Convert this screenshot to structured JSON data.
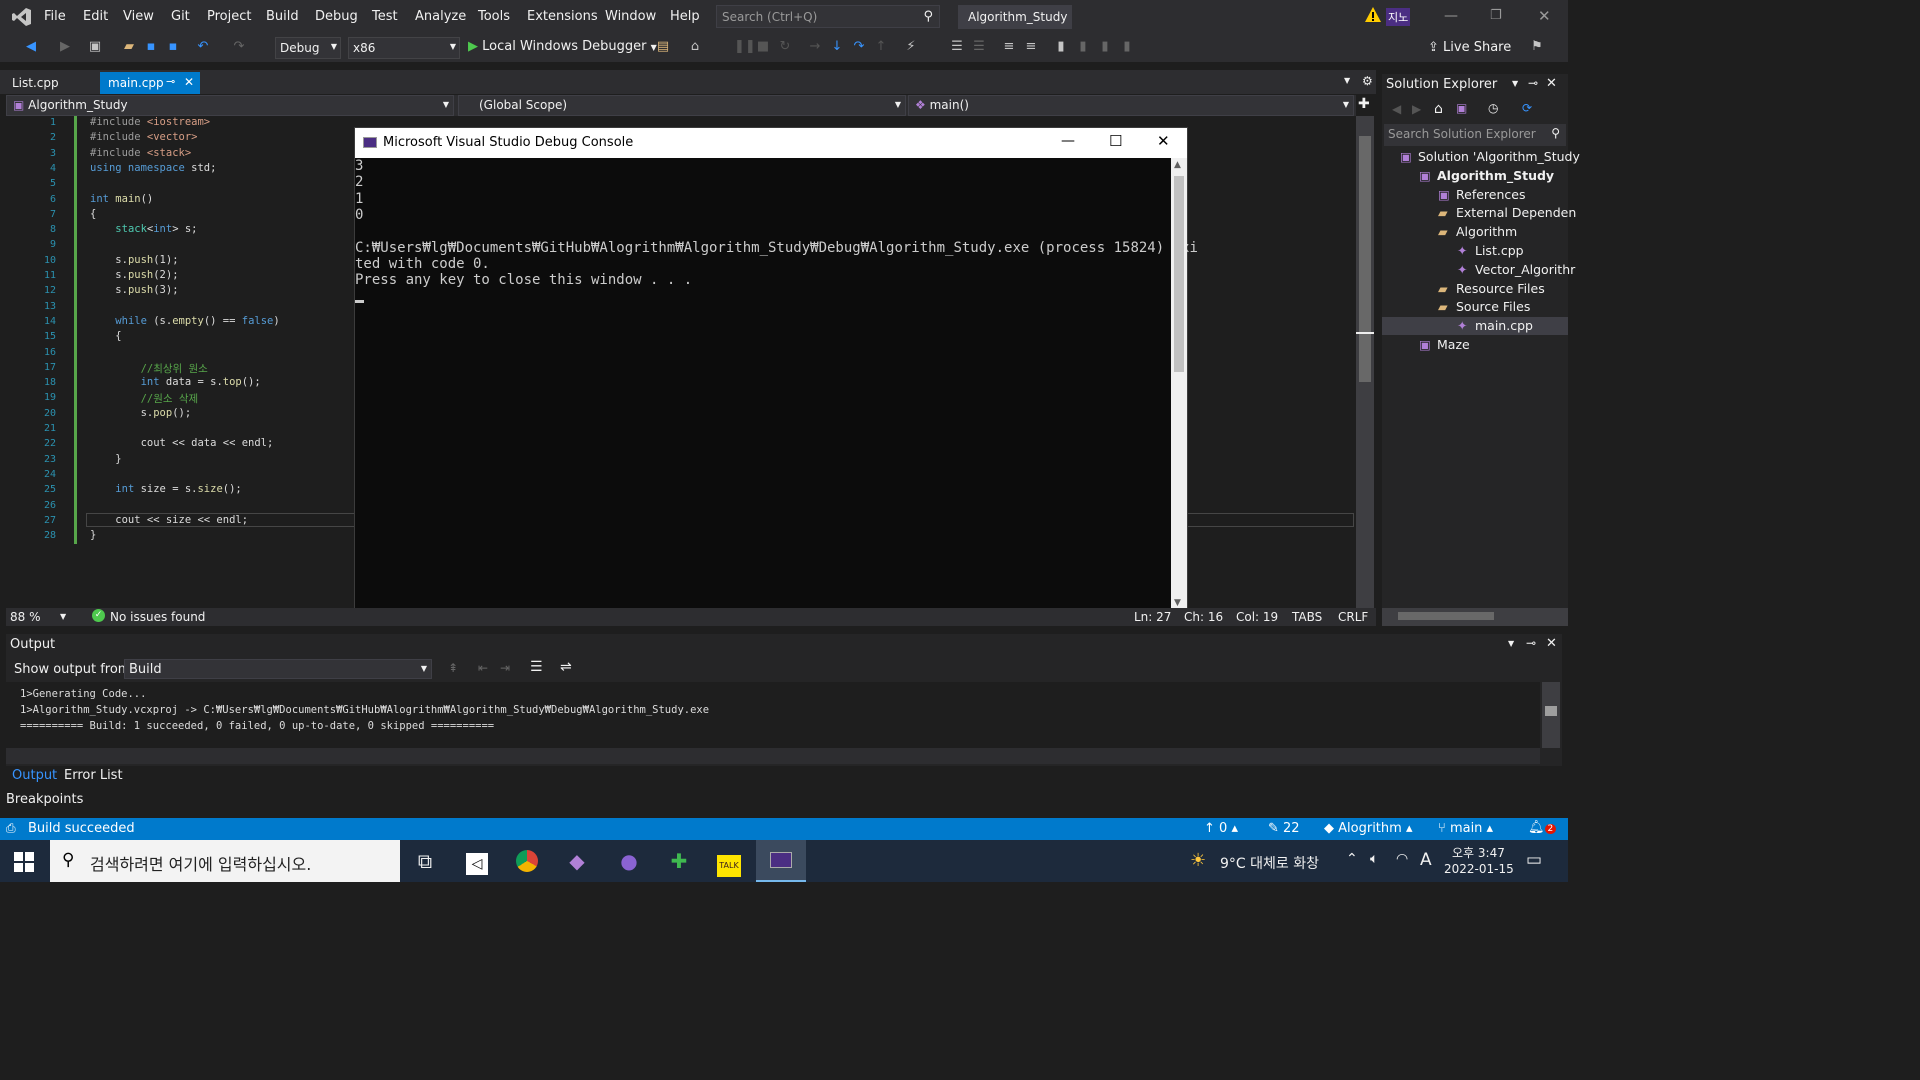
{
  "app": {
    "title": "Algorithm_Study"
  },
  "menu": [
    "File",
    "Edit",
    "View",
    "Git",
    "Project",
    "Build",
    "Debug",
    "Test",
    "Analyze",
    "Tools",
    "Extensions",
    "Window",
    "Help"
  ],
  "search": {
    "placeholder": "Search (Ctrl+Q)"
  },
  "user": {
    "initials": "지노"
  },
  "toolbar": {
    "config": "Debug",
    "platform": "x86",
    "debugger": "Local Windows Debugger",
    "live_share": "Live Share"
  },
  "tabs": [
    {
      "label": "List.cpp"
    },
    {
      "label": "main.cpp"
    }
  ],
  "nav": {
    "project": "Algorithm_Study",
    "scope": "(Global Scope)",
    "member": "main()"
  },
  "code_lines": [
    {
      "n": "1",
      "html": "<span class=\"mac\">#include</span> <span class=\"str\">&lt;iostream&gt;</span>"
    },
    {
      "n": "2",
      "html": "<span class=\"mac\">#include</span> <span class=\"str\">&lt;vector&gt;</span>"
    },
    {
      "n": "3",
      "html": "<span class=\"mac\">#include</span> <span class=\"str\">&lt;stack&gt;</span>"
    },
    {
      "n": "4",
      "html": "<span class=\"kw\">using namespace</span> std;"
    },
    {
      "n": "5",
      "html": ""
    },
    {
      "n": "6",
      "html": "<span class=\"kw\">int</span> <span class=\"fn\">main</span>()"
    },
    {
      "n": "7",
      "html": "{"
    },
    {
      "n": "8",
      "html": "    <span class=\"ty\">stack</span>&lt;<span class=\"kw\">int</span>&gt; s;"
    },
    {
      "n": "9",
      "html": ""
    },
    {
      "n": "10",
      "html": "    s.<span class=\"fn\">push</span>(1);"
    },
    {
      "n": "11",
      "html": "    s.<span class=\"fn\">push</span>(2);"
    },
    {
      "n": "12",
      "html": "    s.<span class=\"fn\">push</span>(3);"
    },
    {
      "n": "13",
      "html": ""
    },
    {
      "n": "14",
      "html": "    <span class=\"kw\">while</span> (s.<span class=\"fn\">empty</span>() == <span class=\"kw\">false</span>)"
    },
    {
      "n": "15",
      "html": "    {"
    },
    {
      "n": "16",
      "html": ""
    },
    {
      "n": "17",
      "html": "        <span class=\"cm\">//최상위 원소</span>"
    },
    {
      "n": "18",
      "html": "        <span class=\"kw\">int</span> data = s.<span class=\"fn\">top</span>();"
    },
    {
      "n": "19",
      "html": "        <span class=\"cm\">//원소 삭제</span>"
    },
    {
      "n": "20",
      "html": "        s.<span class=\"fn\">pop</span>();"
    },
    {
      "n": "21",
      "html": ""
    },
    {
      "n": "22",
      "html": "        cout &lt;&lt; data &lt;&lt; endl;"
    },
    {
      "n": "23",
      "html": "    }"
    },
    {
      "n": "24",
      "html": ""
    },
    {
      "n": "25",
      "html": "    <span class=\"kw\">int</span> size = s.<span class=\"fn\">size</span>();"
    },
    {
      "n": "26",
      "html": ""
    },
    {
      "n": "27",
      "html": "    cout &lt;&lt; size &lt;&lt; endl;"
    },
    {
      "n": "28",
      "html": "}"
    }
  ],
  "console": {
    "title": "Microsoft Visual Studio Debug Console",
    "lines": [
      "3",
      "2",
      "1",
      "0",
      "",
      "C:₩Users₩lg₩Documents₩GitHub₩Alogrithm₩Algorithm_Study₩Debug₩Algorithm_Study.exe (process 15824) exi",
      "ted with code 0.",
      "Press any key to close this window . . ."
    ]
  },
  "editor_status": {
    "zoom": "88 %",
    "issues": "No issues found",
    "ln": "Ln: 27",
    "ch": "Ch: 16",
    "col": "Col: 19",
    "tabs": "TABS",
    "crlf": "CRLF"
  },
  "solution_explorer": {
    "title": "Solution Explorer",
    "search_placeholder": "Search Solution Explorer",
    "items": [
      {
        "label": "Solution 'Algorithm_Study",
        "indent": 0,
        "icon": "solution-icon"
      },
      {
        "label": "Algorithm_Study",
        "indent": 1,
        "icon": "project-icon",
        "bold": true
      },
      {
        "label": "References",
        "indent": 2,
        "icon": "references-icon"
      },
      {
        "label": "External Dependen",
        "indent": 2,
        "icon": "folder-icon"
      },
      {
        "label": "Algorithm",
        "indent": 2,
        "icon": "folder-icon"
      },
      {
        "label": "List.cpp",
        "indent": 3,
        "icon": "cpp-file-icon"
      },
      {
        "label": "Vector_Algorithr",
        "indent": 3,
        "icon": "cpp-file-icon"
      },
      {
        "label": "Resource Files",
        "indent": 2,
        "icon": "folder-icon"
      },
      {
        "label": "Source Files",
        "indent": 2,
        "icon": "folder-icon"
      },
      {
        "label": "main.cpp",
        "indent": 3,
        "icon": "cpp-file-icon",
        "selected": true
      },
      {
        "label": "Maze",
        "indent": 1,
        "icon": "project-icon"
      }
    ]
  },
  "output": {
    "title": "Output",
    "show_from_label": "Show output from:",
    "source": "Build",
    "lines": [
      "1>Generating Code...",
      "1>Algorithm_Study.vcxproj -> C:₩Users₩lg₩Documents₩GitHub₩Alogrithm₩Algorithm_Study₩Debug₩Algorithm_Study.exe",
      "========== Build: 1 succeeded, 0 failed, 0 up-to-date, 0 skipped =========="
    ],
    "tabs": [
      "Output",
      "Error List"
    ],
    "breakpoints": "Breakpoints"
  },
  "statusbar": {
    "text": "Build succeeded",
    "up": "0",
    "edits": "22",
    "repo": "Alogrithm",
    "branch": "main",
    "notif": "2"
  },
  "taskbar": {
    "search_placeholder": "검색하려면 여기에 입력하십시오.",
    "weather": "9°C  대체로 화창",
    "ime": "A",
    "time": "오후 3:47",
    "date": "2022-01-15"
  }
}
